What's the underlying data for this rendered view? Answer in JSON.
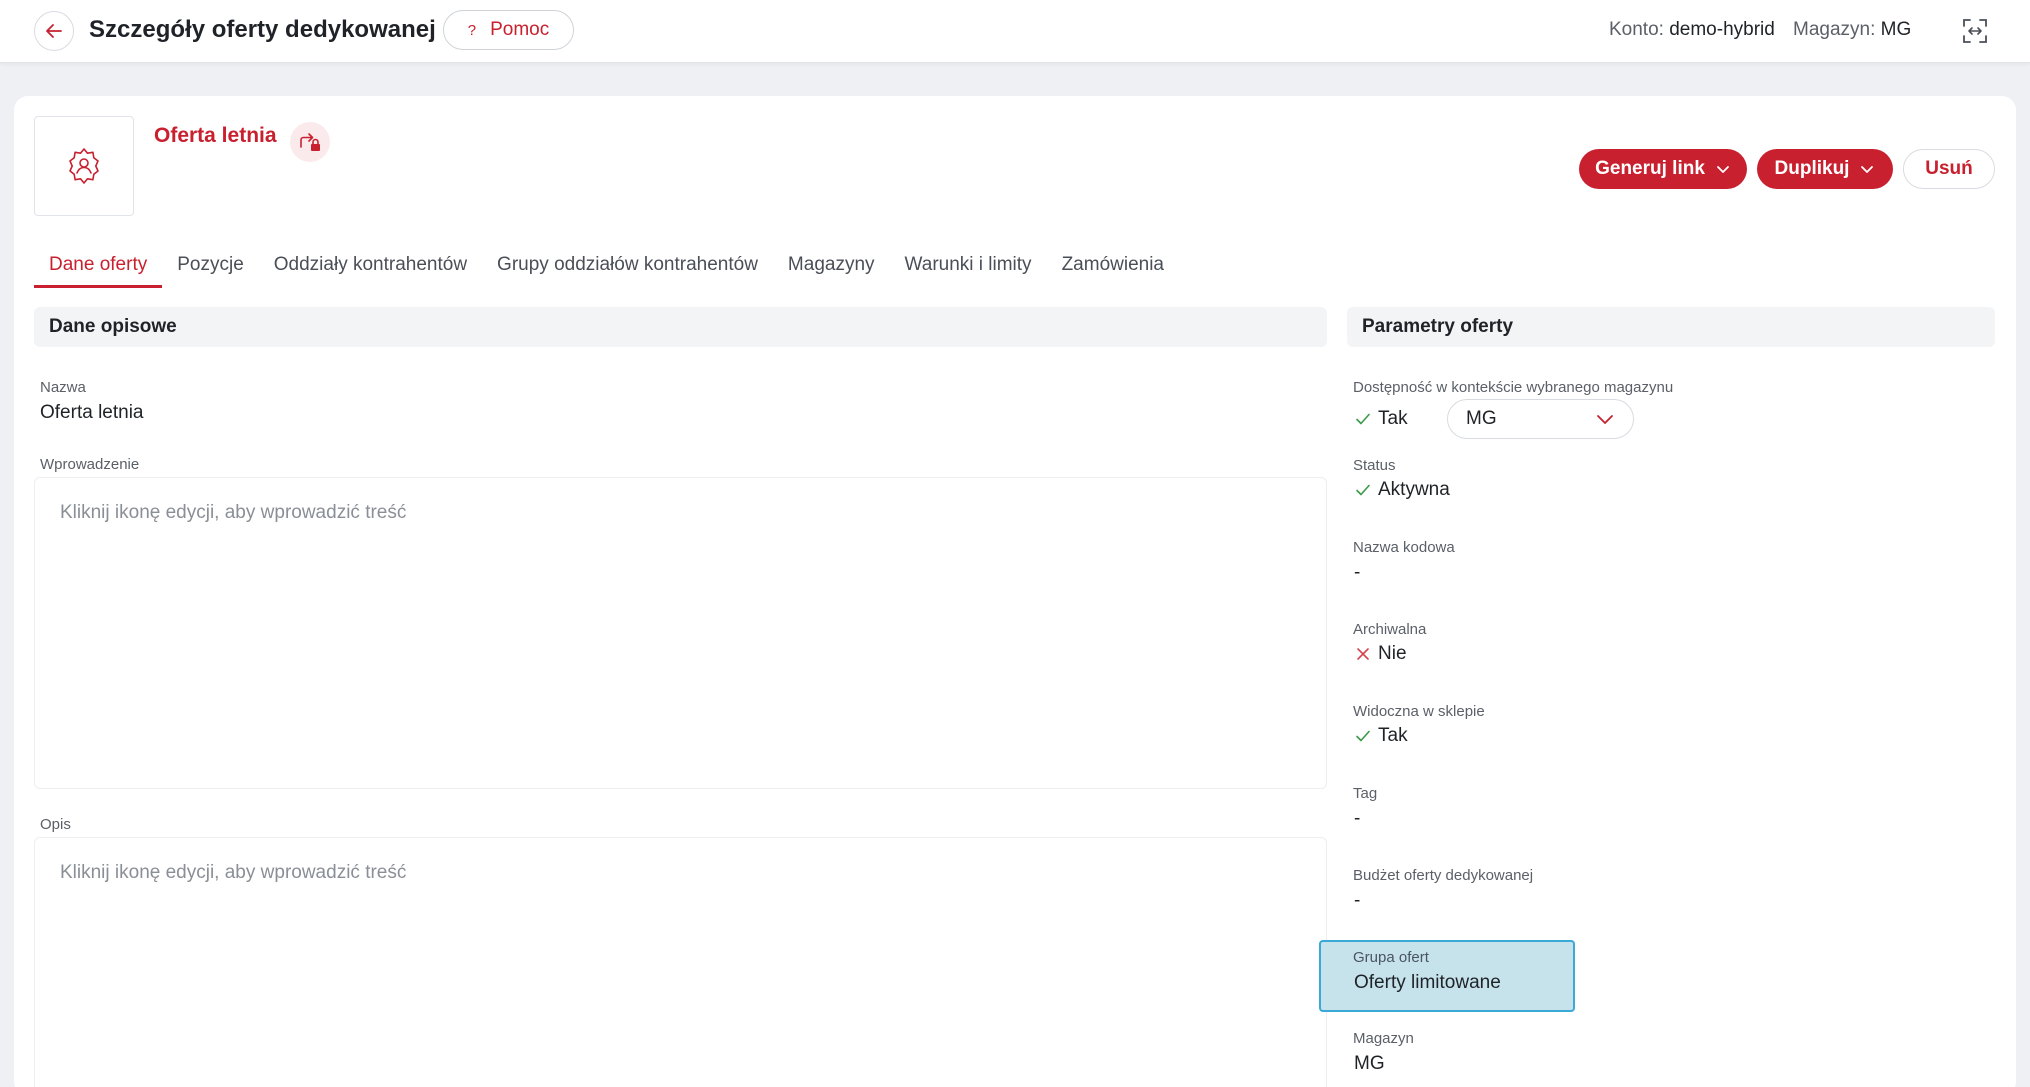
{
  "header": {
    "title": "Szczegóły oferty dedykowanej",
    "help_label": "Pomoc",
    "account_label": "Konto:",
    "account_value": "demo-hybrid",
    "warehouse_label": "Magazyn:",
    "warehouse_value": "MG"
  },
  "offer": {
    "name": "Oferta letnia"
  },
  "actions": {
    "generate_link": "Generuj link",
    "duplicate": "Duplikuj",
    "delete": "Usuń"
  },
  "tabs": [
    {
      "label": "Dane oferty",
      "active": true
    },
    {
      "label": "Pozycje"
    },
    {
      "label": "Oddziały kontrahentów"
    },
    {
      "label": "Grupy oddziałów kontrahentów"
    },
    {
      "label": "Magazyny"
    },
    {
      "label": "Warunki i limity"
    },
    {
      "label": "Zamówienia"
    }
  ],
  "descriptive": {
    "heading": "Dane opisowe",
    "name_label": "Nazwa",
    "name_value": "Oferta letnia",
    "intro_label": "Wprowadzenie",
    "intro_placeholder": "Kliknij ikonę edycji, aby wprowadzić treść",
    "desc_label": "Opis",
    "desc_placeholder": "Kliknij ikonę edycji, aby wprowadzić treść"
  },
  "params": {
    "heading": "Parametry oferty",
    "availability_label": "Dostępność w kontekście wybranego magazynu",
    "availability_value": "Tak",
    "availability_select": "MG",
    "status_label": "Status",
    "status_value": "Aktywna",
    "code_label": "Nazwa kodowa",
    "code_value": "-",
    "archived_label": "Archiwalna",
    "archived_value": "Nie",
    "visible_label": "Widoczna w sklepie",
    "visible_value": "Tak",
    "tag_label": "Tag",
    "tag_value": "-",
    "budget_label": "Budżet oferty dedykowanej",
    "budget_value": "-",
    "group_label": "Grupa ofert",
    "group_value": "Oferty limitowane",
    "warehouse_label": "Magazyn",
    "warehouse_value": "MG"
  },
  "colors": {
    "accent": "#c8202f",
    "check": "#3a9a4a",
    "cross": "#d9434f",
    "highlight": "#c6e3ec"
  }
}
